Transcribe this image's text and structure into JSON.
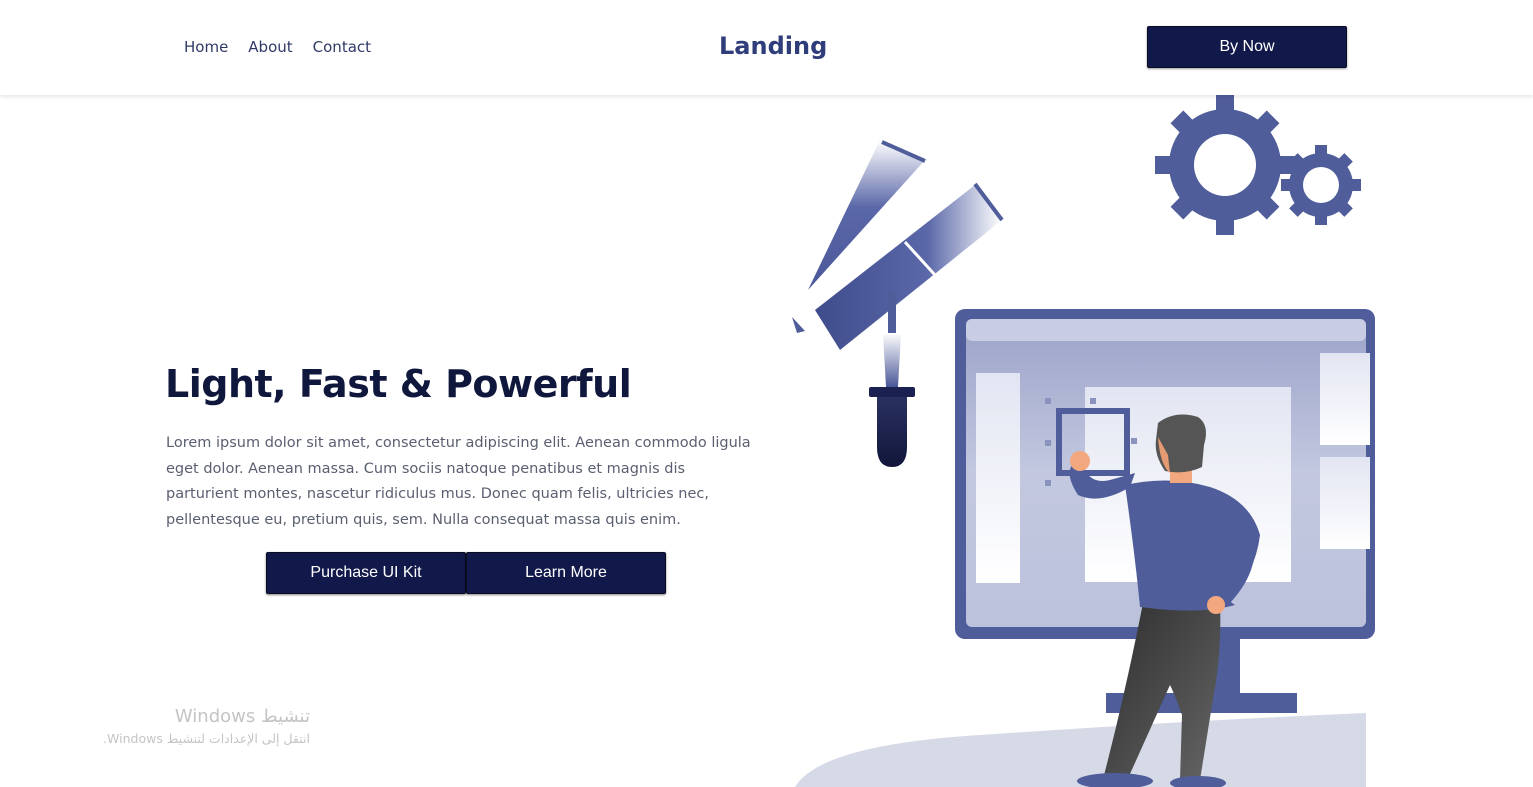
{
  "header": {
    "nav": [
      "Home",
      "About",
      "Contact"
    ],
    "brand": "Landing",
    "cta_label": "By Now"
  },
  "hero": {
    "title": "Light, Fast & Powerful",
    "body": "Lorem ipsum dolor sit amet, consectetur adipiscing elit. Aenean commodo ligula eget dolor. Aenean massa. Cum sociis natoque penatibus et magnis dis parturient montes, nascetur ridiculus mus. Donec quam felis, ultricies nec, pellentesque eu, pretium quis, sem. Nulla consequat massa quis enim.",
    "primary_button": "Purchase UI Kit",
    "secondary_button": "Learn More"
  },
  "illustration": {
    "icons": [
      "gear-icon",
      "gear-icon",
      "color-swatch-icon",
      "pipette-icon",
      "monitor-icon",
      "person-illustration"
    ]
  },
  "watermark": {
    "title": "تنشيط Windows",
    "subtitle": "انتقل إلى الإعدادات لتنشيط Windows."
  },
  "colors": {
    "primary": "#11184a",
    "accent": "#5260a0",
    "heading": "#10173d",
    "brand": "#2f3d7a",
    "nav": "#2f3a66",
    "text": "#5a5f70"
  }
}
